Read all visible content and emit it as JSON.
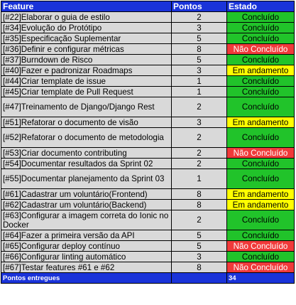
{
  "headers": {
    "feature": "Feature",
    "points": "Pontos",
    "status": "Estado"
  },
  "rows": [
    {
      "feature": "[#22]Elaborar o guia de estilo",
      "points": "2",
      "status": "Concluído",
      "kind": "concluido",
      "lines": 1
    },
    {
      "feature": "[#34]Evolução do Protótipo",
      "points": "3",
      "status": "Concluído",
      "kind": "concluido",
      "lines": 1
    },
    {
      "feature": "[#35]Especificação Suplementar",
      "points": "5",
      "status": "Concluído",
      "kind": "concluido",
      "lines": 1
    },
    {
      "feature": "[#36]Definir e configurar métricas",
      "points": "8",
      "status": "Não Concluído",
      "kind": "nao",
      "lines": 1
    },
    {
      "feature": "[#37]Burndown de Risco",
      "points": "5",
      "status": "Concluído",
      "kind": "concluido",
      "lines": 1
    },
    {
      "feature": "[#40]Fazer e padronizar Roadmaps",
      "points": "3",
      "status": "Em andamento",
      "kind": "andamento",
      "lines": 1
    },
    {
      "feature": "[#44]Criar template de issue",
      "points": "1",
      "status": "Concluído",
      "kind": "concluido",
      "lines": 1
    },
    {
      "feature": "[#45]Criar template de Pull Request",
      "points": "1",
      "status": "Concluído",
      "kind": "concluido",
      "lines": 1
    },
    {
      "feature": "[#47]Treinamento de Django/Django Rest",
      "points": "2",
      "status": "Concluído",
      "kind": "concluido",
      "lines": 2
    },
    {
      "feature": "[#51]Refatorar o documento de visão",
      "points": "3",
      "status": "Em andamento",
      "kind": "andamento",
      "lines": 1
    },
    {
      "feature": "[#52]Refatorar o documento de metodologia",
      "points": "2",
      "status": "Concluído",
      "kind": "concluido",
      "lines": 2
    },
    {
      "feature": "[#53]Criar documento contributing",
      "points": "2",
      "status": "Não Concluído",
      "kind": "nao",
      "lines": 1
    },
    {
      "feature": "[#54]Documentar resultados da Sprint 02",
      "points": "2",
      "status": "Concluído",
      "kind": "concluido",
      "lines": 1
    },
    {
      "feature": "[#55]Documentar planejamento da Sprint 03",
      "points": "1",
      "status": "Concluído",
      "kind": "concluido",
      "lines": 2
    },
    {
      "feature": "[#61]Cadastrar um voluntário(Frontend)",
      "points": "8",
      "status": "Em andamento",
      "kind": "andamento",
      "lines": 1
    },
    {
      "feature": "[#62]Cadastrar um voluntário(Backend)",
      "points": "8",
      "status": "Em andamento",
      "kind": "andamento",
      "lines": 1
    },
    {
      "feature": "[#63]Configurar a imagem correta do Ionic no Docker",
      "points": "2",
      "status": "Concluído",
      "kind": "concluido",
      "lines": 2
    },
    {
      "feature": "[#64]Fazer a primeira versão da API",
      "points": "5",
      "status": "Concluído",
      "kind": "concluido",
      "lines": 1
    },
    {
      "feature": "[#65]Configurar deploy contínuo",
      "points": "5",
      "status": "Não Concluído",
      "kind": "nao",
      "lines": 1
    },
    {
      "feature": "[#66]Configurar linting automático",
      "points": "3",
      "status": "Concluído",
      "kind": "concluido",
      "lines": 1
    },
    {
      "feature": "[#67]Testar features #61 e #62",
      "points": "8",
      "status": "Não Concluído",
      "kind": "nao",
      "lines": 1
    }
  ],
  "total": {
    "label": "Pontos entregues",
    "value": "34"
  }
}
